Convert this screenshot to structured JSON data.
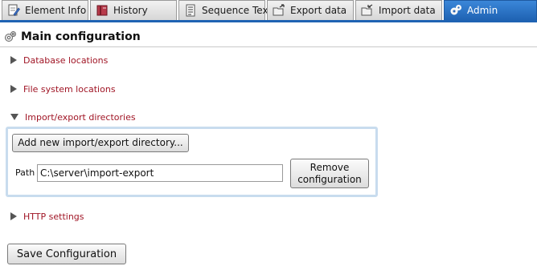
{
  "tabs": [
    {
      "label": "Element Info",
      "icon": "document-edit-icon"
    },
    {
      "label": "History",
      "icon": "book-icon"
    },
    {
      "label": "Sequence Text",
      "icon": "text-document-icon"
    },
    {
      "label": "Export data",
      "icon": "folder-export-icon"
    },
    {
      "label": "Import data",
      "icon": "folder-import-icon"
    },
    {
      "label": "Admin",
      "icon": "gear-icon",
      "active": true
    }
  ],
  "panel": {
    "title": "Main configuration",
    "icon": "gear-icon"
  },
  "sections": {
    "database": "Database locations",
    "filesystem": "File system locations",
    "importexport": "Import/export directories",
    "http": "HTTP settings"
  },
  "importexport": {
    "add_button": "Add new import/export directory...",
    "path_label": "Path",
    "path_value": "C:\\server\\import-export",
    "remove_button_line1": "Remove",
    "remove_button_line2": "configuration"
  },
  "footer": {
    "save_button": "Save Configuration"
  },
  "colors": {
    "accent": "#1f63b3",
    "section_link": "#a01525",
    "box_border": "#c8dcee"
  }
}
